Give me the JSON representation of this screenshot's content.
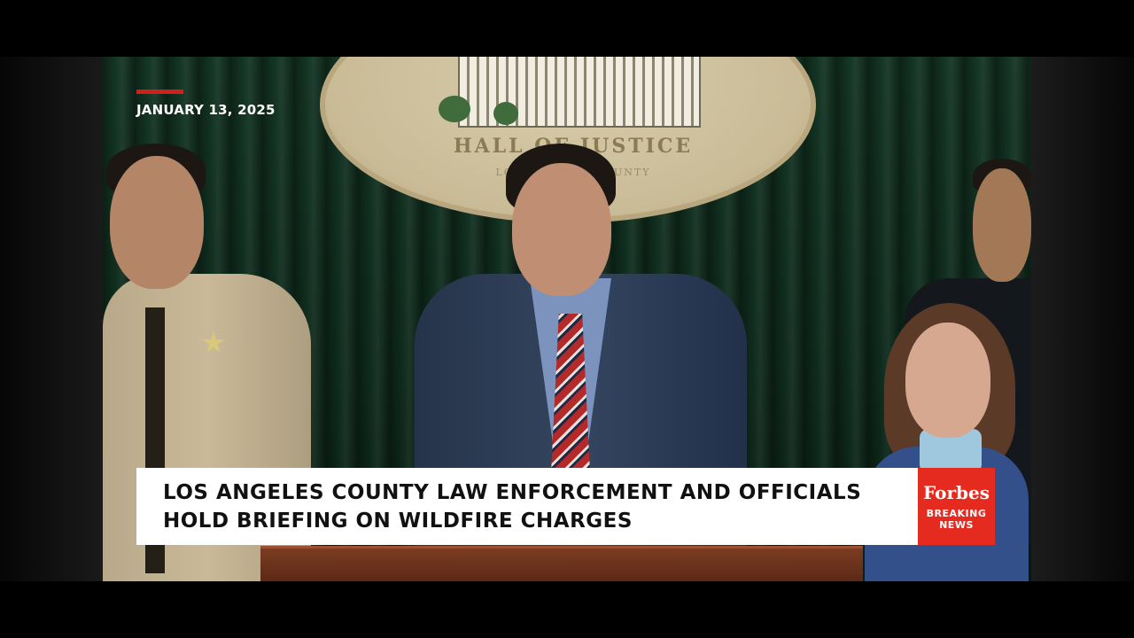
{
  "overlay": {
    "date": "JANUARY 13, 2025",
    "headline_line1": "LOS ANGELES COUNTY LAW ENFORCEMENT AND OFFICIALS",
    "headline_line2": "HOLD BRIEFING ON WILDFIRE CHARGES"
  },
  "branding": {
    "logo": "Forbes",
    "tag_line1": "BREAKING",
    "tag_line2": "NEWS",
    "accent_color": "#e52a1f"
  },
  "background": {
    "seal_text": "HALL OF JUSTICE",
    "seal_subtext": "LOS ANGELES COUNTY"
  }
}
